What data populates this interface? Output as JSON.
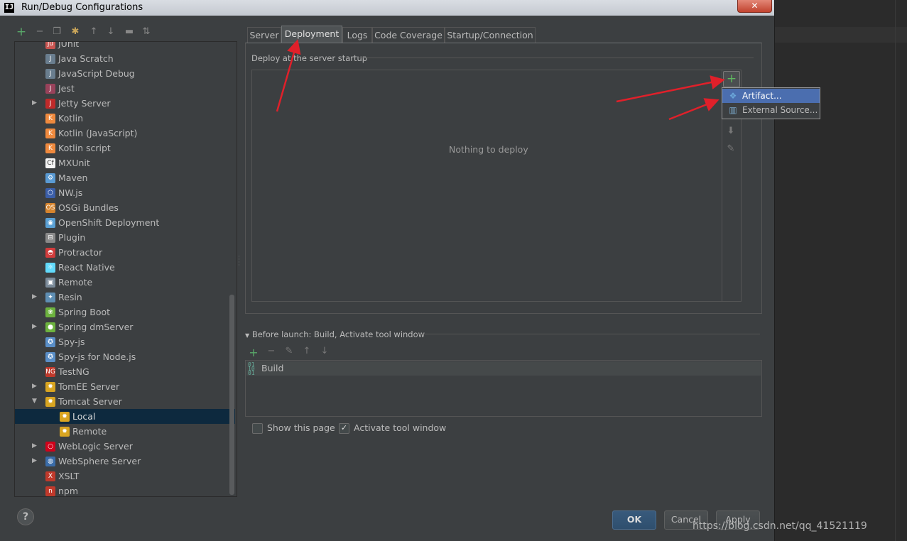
{
  "window": {
    "title": "Run/Debug Configurations",
    "close_label": "✕"
  },
  "left_toolbar": {
    "icons": [
      "add-icon",
      "remove-icon",
      "copy-icon",
      "settings-icon",
      "move-up-icon",
      "move-down-icon",
      "folder-icon",
      "sort-icon"
    ]
  },
  "tree": {
    "items": [
      {
        "label": "JUnit",
        "icon": "junit-icon",
        "indent": 1,
        "expandable": false
      },
      {
        "label": "Java Scratch",
        "icon": "java-scratch-icon",
        "indent": 1,
        "expandable": false
      },
      {
        "label": "JavaScript Debug",
        "icon": "javascript-debug-icon",
        "indent": 1,
        "expandable": false
      },
      {
        "label": "Jest",
        "icon": "jest-icon",
        "indent": 1,
        "expandable": false
      },
      {
        "label": "Jetty Server",
        "icon": "jetty-icon",
        "indent": 1,
        "expandable": true,
        "expanded": false
      },
      {
        "label": "Kotlin",
        "icon": "kotlin-icon",
        "indent": 1,
        "expandable": false
      },
      {
        "label": "Kotlin (JavaScript)",
        "icon": "kotlin-icon",
        "indent": 1,
        "expandable": false
      },
      {
        "label": "Kotlin script",
        "icon": "kotlin-icon",
        "indent": 1,
        "expandable": false
      },
      {
        "label": "MXUnit",
        "icon": "mxunit-icon",
        "indent": 1,
        "expandable": false
      },
      {
        "label": "Maven",
        "icon": "maven-icon",
        "indent": 1,
        "expandable": false
      },
      {
        "label": "NW.js",
        "icon": "nwjs-icon",
        "indent": 1,
        "expandable": false
      },
      {
        "label": "OSGi Bundles",
        "icon": "osgi-icon",
        "indent": 1,
        "expandable": false
      },
      {
        "label": "OpenShift Deployment",
        "icon": "openshift-icon",
        "indent": 1,
        "expandable": false
      },
      {
        "label": "Plugin",
        "icon": "plugin-icon",
        "indent": 1,
        "expandable": false
      },
      {
        "label": "Protractor",
        "icon": "protractor-icon",
        "indent": 1,
        "expandable": false
      },
      {
        "label": "React Native",
        "icon": "react-icon",
        "indent": 1,
        "expandable": false
      },
      {
        "label": "Remote",
        "icon": "remote-icon",
        "indent": 1,
        "expandable": false
      },
      {
        "label": "Resin",
        "icon": "resin-icon",
        "indent": 1,
        "expandable": true,
        "expanded": false
      },
      {
        "label": "Spring Boot",
        "icon": "spring-boot-icon",
        "indent": 1,
        "expandable": false
      },
      {
        "label": "Spring dmServer",
        "icon": "spring-dm-icon",
        "indent": 1,
        "expandable": true,
        "expanded": false
      },
      {
        "label": "Spy-js",
        "icon": "spyjs-icon",
        "indent": 1,
        "expandable": false
      },
      {
        "label": "Spy-js for Node.js",
        "icon": "spyjs-icon",
        "indent": 1,
        "expandable": false
      },
      {
        "label": "TestNG",
        "icon": "testng-icon",
        "indent": 1,
        "expandable": false
      },
      {
        "label": "TomEE Server",
        "icon": "tomee-icon",
        "indent": 1,
        "expandable": true,
        "expanded": false
      },
      {
        "label": "Tomcat Server",
        "icon": "tomcat-icon",
        "indent": 1,
        "expandable": true,
        "expanded": true
      },
      {
        "label": "Local",
        "icon": "tomcat-icon",
        "indent": 2,
        "expandable": false,
        "selected": true
      },
      {
        "label": "Remote",
        "icon": "tomcat-icon",
        "indent": 2,
        "expandable": false
      },
      {
        "label": "WebLogic Server",
        "icon": "weblogic-icon",
        "indent": 1,
        "expandable": true,
        "expanded": false
      },
      {
        "label": "WebSphere Server",
        "icon": "websphere-icon",
        "indent": 1,
        "expandable": true,
        "expanded": false
      },
      {
        "label": "XSLT",
        "icon": "xslt-icon",
        "indent": 1,
        "expandable": false
      },
      {
        "label": "npm",
        "icon": "npm-icon",
        "indent": 1,
        "expandable": false
      }
    ]
  },
  "tabs": [
    {
      "label": "Server",
      "active": false
    },
    {
      "label": "Deployment",
      "active": true
    },
    {
      "label": "Logs",
      "active": false
    },
    {
      "label": "Code Coverage",
      "active": false
    },
    {
      "label": "Startup/Connection",
      "active": false
    }
  ],
  "deployment": {
    "section_label": "Deploy at the server startup",
    "empty_text": "Nothing to deploy",
    "add_label": "+",
    "popup": [
      {
        "label": "Artifact...",
        "icon": "artifact-icon",
        "highlighted": true
      },
      {
        "label": "External Source...",
        "icon": "external-source-icon",
        "highlighted": false
      }
    ]
  },
  "before_launch": {
    "header": "Before launch: Build, Activate tool window",
    "items": [
      {
        "label": "Build",
        "icon": "build-icon"
      }
    ]
  },
  "options": {
    "show_this_page": {
      "label": "Show this page",
      "checked": false
    },
    "activate_tool_window": {
      "label": "Activate tool window",
      "checked": true
    }
  },
  "buttons": {
    "help": "?",
    "ok": "OK",
    "cancel": "Cancel",
    "apply": "Apply"
  },
  "watermark": "https://blog.csdn.net/qq_41521119",
  "colors": {
    "selection": "#0d293e",
    "popup_highlight": "#4b6eaf",
    "ok_button": "#385a7c",
    "annotation_arrow": "#e0202a"
  }
}
